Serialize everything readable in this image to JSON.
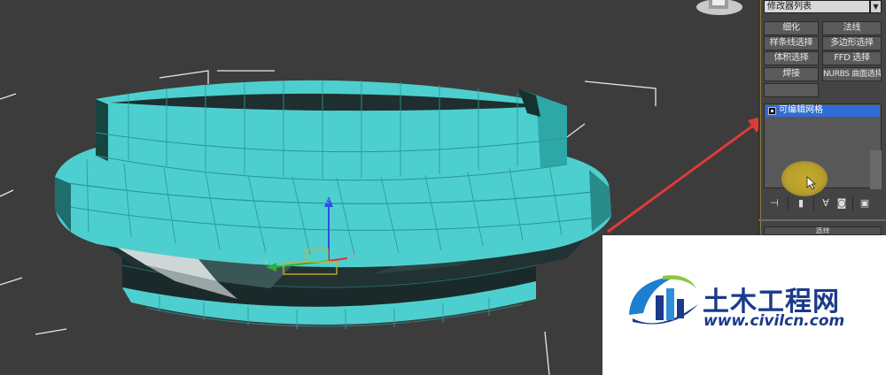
{
  "viewport": {
    "mesh_color": "#4ecfcf",
    "background": "#3c3c3c",
    "gizmo_axis_labels": [
      "z",
      "x",
      "y"
    ]
  },
  "command_panel": {
    "modifier_list_label": "修改器列表",
    "buttons": [
      [
        "细化",
        "法线"
      ],
      [
        "样条线选择",
        "多边形选择"
      ],
      [
        "体积选择",
        "FFD 选择"
      ],
      [
        "焊接",
        "NURBS 曲面选择"
      ]
    ],
    "stack_item": "可编辑网格",
    "stack_selected_color": "#2f6cd6",
    "toolbar_icons": [
      "pin-stack-icon",
      "show-end-result-icon",
      "make-unique-icon",
      "remove-modifier-icon",
      "configure-modifier-sets-icon"
    ],
    "bottom_button": "选择"
  },
  "annotation": {
    "arrow_color": "#e03a3a"
  },
  "watermark": {
    "name": "土木工程网",
    "url": "www.civilcn.com"
  }
}
